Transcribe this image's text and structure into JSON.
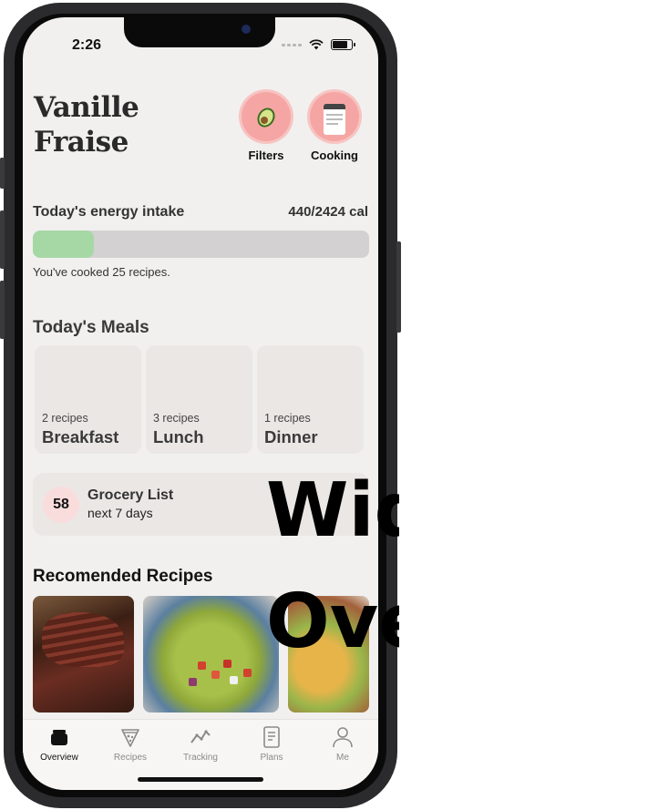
{
  "status": {
    "time": "2:26"
  },
  "app": {
    "title_line1": "Vanille",
    "title_line2": "Fraise"
  },
  "quick_actions": [
    {
      "label": "Filters",
      "icon": "avocado-icon"
    },
    {
      "label": "Cooking",
      "icon": "calendar-icon"
    }
  ],
  "energy": {
    "title": "Today's energy intake",
    "value": "440/2424 cal",
    "consumed": 440,
    "goal": 2424
  },
  "cooked_text": "You've cooked 25 recipes.",
  "meals": {
    "title": "Today's Meals",
    "items": [
      {
        "count": "2 recipes",
        "name": "Breakfast"
      },
      {
        "count": "3 recipes",
        "name": "Lunch"
      },
      {
        "count": "1 recipes",
        "name": "Dinner"
      }
    ]
  },
  "grocery": {
    "count": "58",
    "title": "Grocery List",
    "subtitle": "next 7 days"
  },
  "recommended": {
    "title": "Recomended Recipes"
  },
  "tabs": [
    {
      "label": "Overview",
      "icon": "pot-icon",
      "active": true
    },
    {
      "label": "Recipes",
      "icon": "pizza-icon",
      "active": false
    },
    {
      "label": "Tracking",
      "icon": "chart-line-icon",
      "active": false
    },
    {
      "label": "Plans",
      "icon": "document-icon",
      "active": false
    },
    {
      "label": "Me",
      "icon": "person-icon",
      "active": false
    }
  ],
  "overlay": {
    "line1": "Wid",
    "line2": "Ove"
  },
  "colors": {
    "accent_pink": "#f5a6a4",
    "progress_green": "#a6d8a5",
    "card_bg": "#ebe7e5"
  }
}
